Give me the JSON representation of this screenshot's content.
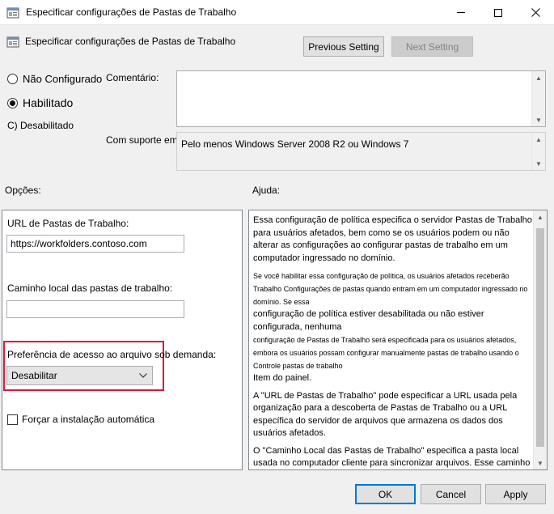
{
  "window": {
    "title": "Especificar configurações de Pastas de Trabalho",
    "header": "Especificar configurações de Pastas de Trabalho",
    "icons": {
      "app": "policy-icon",
      "minimize": "minimize-icon",
      "maximize": "maximize-icon",
      "close": "close-icon"
    }
  },
  "nav": {
    "previous_label": "Previous Setting",
    "next_label": "Next Setting"
  },
  "state": {
    "not_configured": "Não Configurado",
    "enabled": "Habilitado",
    "disabled": "C) Desabilitado",
    "selected": "enabled"
  },
  "comment": {
    "label": "Comentário:",
    "value": ""
  },
  "supported": {
    "label": "Com suporte em:",
    "value": "Pelo menos Windows Server 2008 R2 ou Windows 7"
  },
  "options": {
    "heading": "Opções:",
    "url_label": "URL de Pastas de Trabalho:",
    "url_value": "https://workfolders.contoso.com",
    "local_path_label": "Caminho local das pastas de trabalho:",
    "local_path_value": "",
    "on_demand_label": "Preferência de acesso ao arquivo sob demanda:",
    "on_demand_value": "Desabilitar",
    "force_label": "Forçar a instalação automática",
    "highlight_color": "#d81b3c"
  },
  "help": {
    "heading": "Ajuda:",
    "p1": "Essa configuração de política especifica o servidor Pastas de Trabalho para usuários afetados, bem como se os usuários podem ou não alterar as configurações ao configurar pastas de trabalho em um computador ingressado no domínio.",
    "p2": "Se você habilitar essa configuração de política, os usuários afetados receberão Trabalho Configurações de pastas quando entram em um computador ingressado no domínio. Se essa",
    "p3": "configuração de política estiver desabilitada ou não estiver configurada, nenhuma",
    "p4": "configuração de Pastas de Trabalho será especificada para os usuários afetados, embora os usuários possam configurar manualmente pastas de trabalho usando o Controle pastas de trabalho",
    "p5": "Item do painel.",
    "p6": "A \"URL de Pastas de Trabalho\" pode especificar a URL usada pela organização para a descoberta de Pastas de Trabalho ou a URL específica do servidor de arquivos que armazena os dados dos usuários afetados.",
    "p7": "O \"Caminho Local das Pastas de Trabalho\" especifica a pasta local usada no computador cliente para sincronizar arquivos. Esse caminho pode conter variáveis de ambiente. Observação: para que essa configuração entre em vigor, uma \"URL de Pastas de Trabalho\" válida também deve ser especificada."
  },
  "footer": {
    "ok_label": "OK",
    "cancel_label": "Cancel",
    "apply_label": "Apply"
  }
}
